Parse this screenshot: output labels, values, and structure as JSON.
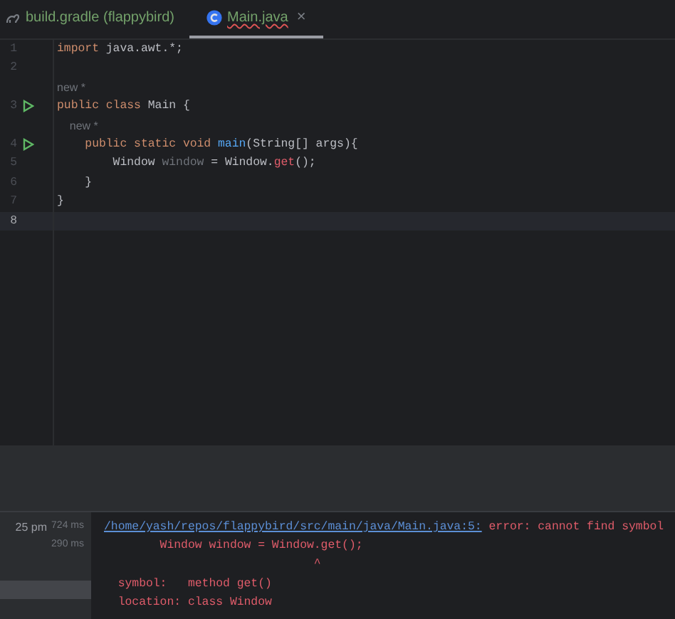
{
  "tabs": [
    {
      "label": "build.gradle (flappybird)",
      "kind": "build_script",
      "selected": false,
      "has_error": false,
      "closable": false
    },
    {
      "label": "Main.java",
      "kind": "source",
      "selected": true,
      "has_error": true,
      "closable": true,
      "close_glyph": "×"
    }
  ],
  "editor": {
    "lines": [
      {
        "kind": "code",
        "number": "1",
        "run": false,
        "current": false,
        "tokens": [
          {
            "kind": "keyword",
            "text": "import"
          },
          {
            "kind": "plain",
            "text": " java.awt.*;"
          }
        ]
      },
      {
        "kind": "code",
        "number": "2",
        "run": false,
        "current": false
      },
      {
        "kind": "hint",
        "text": "new *"
      },
      {
        "kind": "code",
        "number": "3",
        "run": true,
        "current": false,
        "tokens": [
          {
            "kind": "keyword",
            "text": "public class"
          },
          {
            "kind": "plain",
            "text": " Main {"
          }
        ]
      },
      {
        "kind": "hint",
        "text": "    new *"
      },
      {
        "kind": "code",
        "number": "4",
        "run": true,
        "current": false,
        "tokens": [
          {
            "kind": "keyword",
            "text": "    public static void"
          },
          {
            "kind": "method",
            "text": " main"
          },
          {
            "kind": "plain",
            "text": "(String[] args){"
          }
        ]
      },
      {
        "kind": "code",
        "number": "5",
        "run": false,
        "current": false,
        "tokens": [
          {
            "kind": "plain",
            "text": "        Window"
          },
          {
            "kind": "unused",
            "text": " window"
          },
          {
            "kind": "plain",
            "text": " = Window."
          },
          {
            "kind": "error",
            "text": "get"
          },
          {
            "kind": "plain",
            "text": "();"
          }
        ]
      },
      {
        "kind": "code",
        "number": "6",
        "run": false,
        "current": false,
        "tokens": [
          {
            "kind": "plain",
            "text": "    }"
          }
        ]
      },
      {
        "kind": "code",
        "number": "7",
        "run": false,
        "current": false,
        "tokens": [
          {
            "kind": "plain",
            "text": "}"
          }
        ]
      },
      {
        "kind": "code",
        "number": "8",
        "run": false,
        "current": true
      }
    ]
  },
  "build_tree": [
    {
      "time": "25 pm",
      "duration": "724 ms",
      "selected": false
    },
    {
      "duration": "290 ms",
      "selected": false
    },
    {
      "selected": true
    }
  ],
  "console": [
    {
      "link": "/home/yash/repos/flappybird/src/main/java/Main.java:5:",
      "text": " error: cannot find symbol"
    },
    {
      "text": "        Window window = Window.get();"
    },
    {
      "text": "                              ^"
    },
    {
      "text": "  symbol:   method get()"
    },
    {
      "text": "  location: class Window"
    }
  ]
}
